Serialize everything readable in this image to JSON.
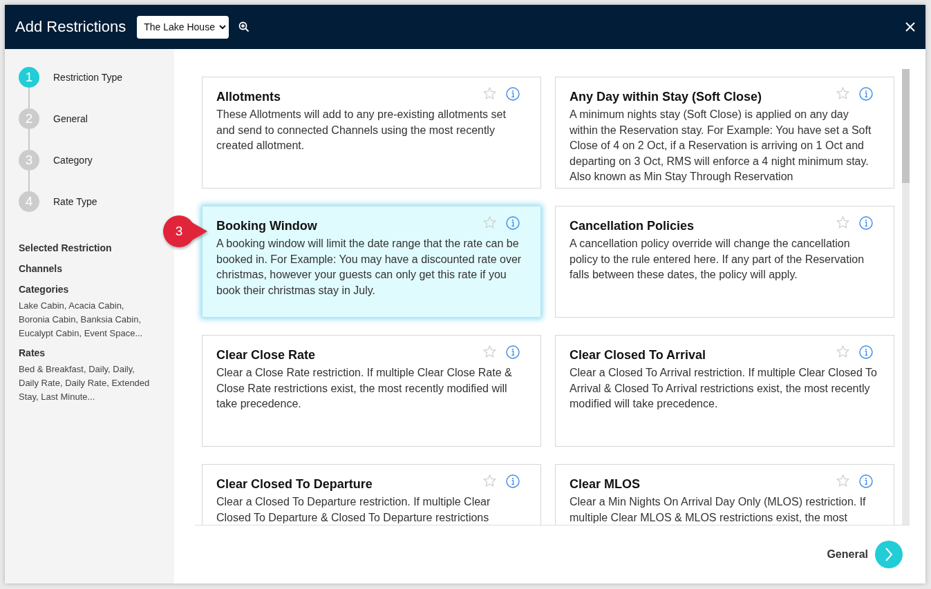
{
  "window": {
    "title": "Add Restrictions"
  },
  "property_select": {
    "value": "The Lake House"
  },
  "steps": [
    {
      "number": "1",
      "label": "Restriction Type",
      "active": true
    },
    {
      "number": "2",
      "label": "General",
      "active": false
    },
    {
      "number": "3",
      "label": "Category",
      "active": false
    },
    {
      "number": "4",
      "label": "Rate Type",
      "active": false
    }
  ],
  "summary": [
    {
      "heading": "Selected Restriction"
    },
    {
      "heading": "Channels"
    },
    {
      "heading": "Categories",
      "text": "Lake Cabin, Acacia Cabin, Boronia Cabin, Banksia Cabin, Eucalypt Cabin, Event Space..."
    },
    {
      "heading": "Rates",
      "text": "Bed & Breakfast, Daily, Daily, Daily Rate, Daily Rate, Extended Stay, Last Minute..."
    }
  ],
  "cards": [
    {
      "title": "Allotments",
      "description": "These Allotments will add to any pre-existing allotments set and send to connected Channels using the most recently created allotment.",
      "selected": false,
      "favorite": false
    },
    {
      "title": "Any Day within Stay (Soft Close)",
      "description": "A minimum nights stay (Soft Close) is applied on any day within the Reservation stay. For Example: You have set a Soft Close of 4 on 2 Oct, if a Reservation is arriving on 1 Oct and departing on 3 Oct, RMS will enforce a 4 night minimum stay. Also known as Min Stay Through Reservation",
      "selected": false,
      "favorite": false
    },
    {
      "title": "Booking Window",
      "description": "A booking window will limit the date range that the rate can be booked in. For Example: You may have a discounted rate over christmas, however your guests can only get this rate if you book their christmas stay in July.",
      "selected": true,
      "favorite": false
    },
    {
      "title": "Cancellation Policies",
      "description": "A cancellation policy override will change the cancellation policy to the rule entered here. If any part of the Reservation falls between these dates, the policy will apply.",
      "selected": false,
      "favorite": false
    },
    {
      "title": "Clear Close Rate",
      "description": "Clear a Close Rate restriction. If multiple Clear Close Rate & Close Rate restrictions exist, the most recently modified will take precedence.",
      "selected": false,
      "favorite": false
    },
    {
      "title": "Clear Closed To Arrival",
      "description": "Clear a Closed To Arrival restriction. If multiple Clear Closed To Arrival & Closed To Arrival restrictions exist, the most recently modified will take precedence.",
      "selected": false,
      "favorite": false
    },
    {
      "title": "Clear Closed To Departure",
      "description": "Clear a Closed To Departure restriction. If multiple Clear Closed To Departure & Closed To Departure restrictions",
      "selected": false,
      "favorite": false
    },
    {
      "title": "Clear MLOS",
      "description": "Clear a Min Nights On Arrival Day Only (MLOS) restriction. If multiple Clear MLOS & MLOS restrictions exist, the most",
      "selected": false,
      "favorite": false
    }
  ],
  "callout": {
    "label": "3"
  },
  "footer": {
    "next_label": "General"
  }
}
